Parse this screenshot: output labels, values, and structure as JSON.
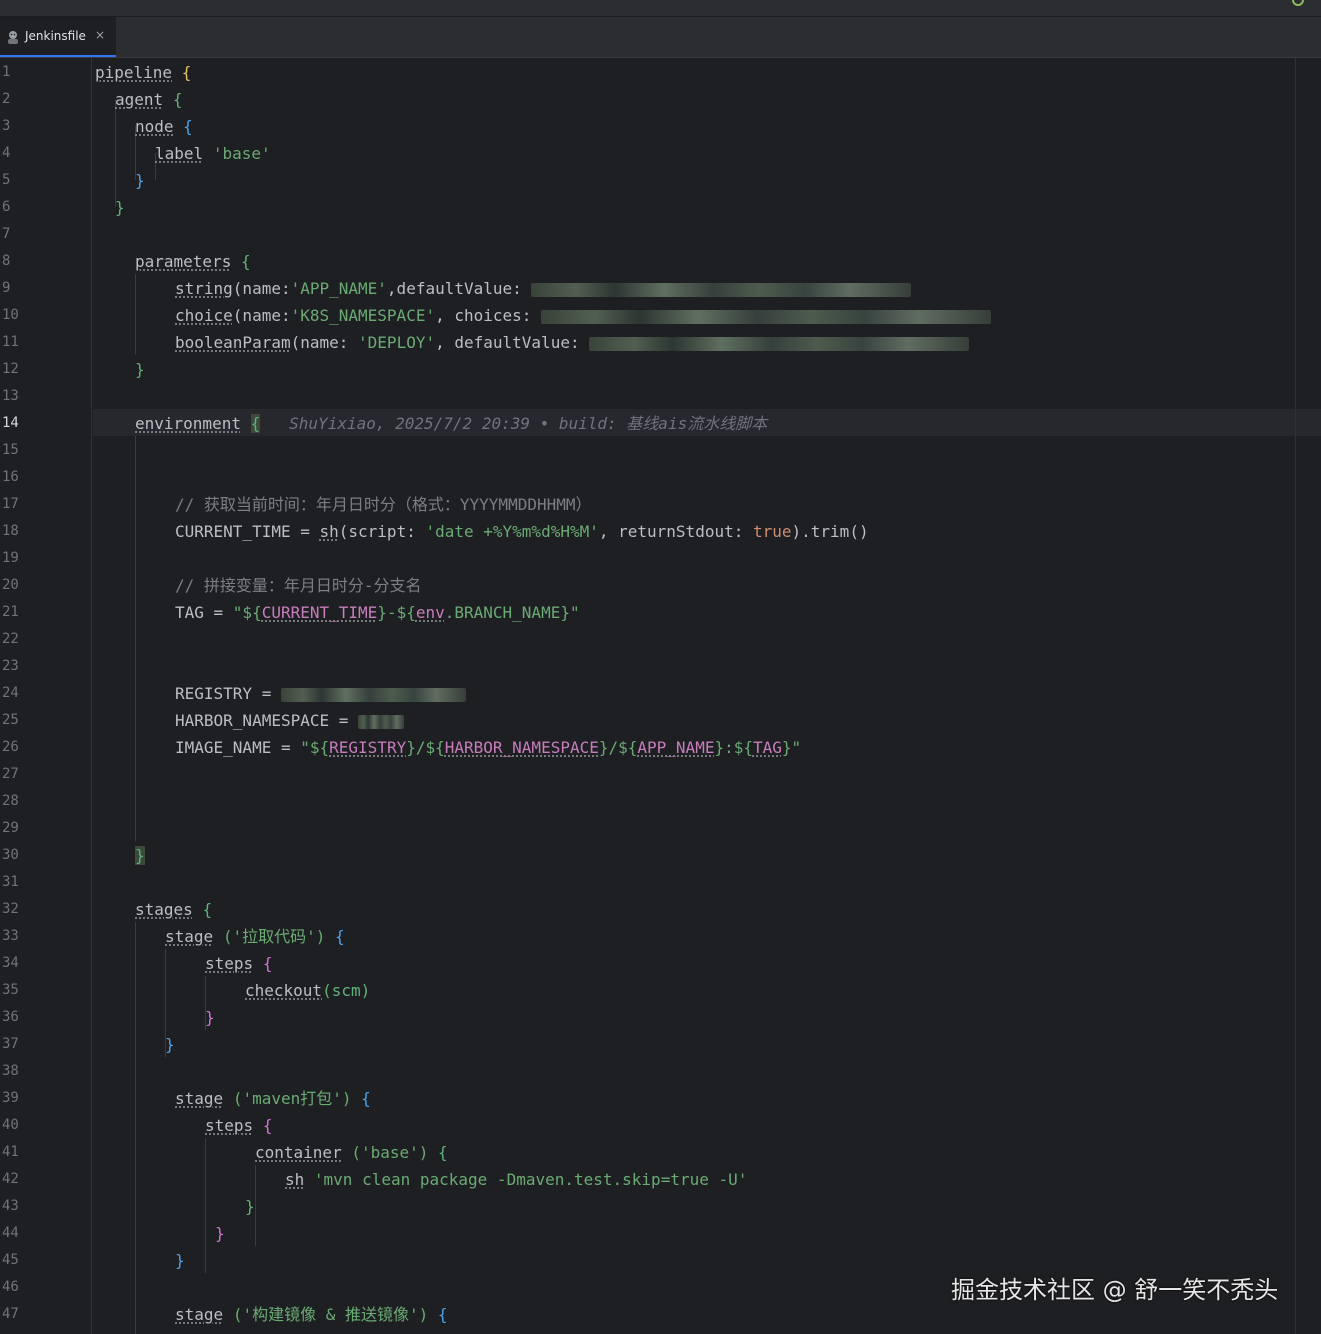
{
  "tab": {
    "label": "Jenkinsfile",
    "close": "×"
  },
  "line_numbers": [
    "1",
    "2",
    "3",
    "4",
    "5",
    "6",
    "7",
    "8",
    "9",
    "10",
    "11",
    "12",
    "13",
    "14",
    "15",
    "16",
    "17",
    "18",
    "19",
    "20",
    "21",
    "22",
    "23",
    "24",
    "25",
    "26",
    "27",
    "28",
    "29",
    "30",
    "31",
    "32",
    "33",
    "34",
    "35",
    "36",
    "37",
    "38",
    "39",
    "40",
    "41",
    "42",
    "43",
    "44",
    "45",
    "46",
    "47"
  ],
  "current_line": "14",
  "code": {
    "l1_kw": "pipeline",
    "l2_kw": "agent",
    "l3_kw": "node",
    "l4_kw": "label",
    "l4_str": "'base'",
    "l8_kw": "parameters",
    "l9_kw": "string",
    "l9_a": "(name:",
    "l9_str": "'APP_NAME'",
    "l9_b": ",defaultValue:",
    "l10_kw": "choice",
    "l10_a": "(name:",
    "l10_str": "'K8S_NAMESPACE'",
    "l10_b": ", choices:",
    "l11_kw": "booleanParam",
    "l11_a": "(name:",
    "l11_str": "'DEPLOY'",
    "l11_b": ", defaultValue:",
    "l14_kw": "environment",
    "l14_blame": "ShuYixiao, 2025/7/2 20:39 • build: 基线ais流水线脚本",
    "l17_cmt": "// 获取当前时间：年月日时分（格式：YYYYMMDDHHMM）",
    "l18_a": "CURRENT_TIME = ",
    "l18_kw": "sh",
    "l18_b": "(script: ",
    "l18_str": "'date +%Y%m%d%H%M'",
    "l18_c": ", returnStdout: ",
    "l18_lit": "true",
    "l18_d": ").trim()",
    "l20_cmt": "// 拼接变量：年月日时分-分支名",
    "l21_a": "TAG = ",
    "l21_q1": "\"${",
    "l21_v1": "CURRENT_TIME",
    "l21_m": "}-${",
    "l21_v2": "env",
    "l21_e": ".BRANCH_NAME}\"",
    "l24_a": "REGISTRY = ",
    "l25_a": "HARBOR_NAMESPACE = ",
    "l26_a": "IMAGE_NAME = ",
    "l26_q": "\"${",
    "l26_v1": "REGISTRY",
    "l26_m1": "}/${",
    "l26_v2": "HARBOR_NAMESPACE",
    "l26_m2": "}/${",
    "l26_v3": "APP_NAME",
    "l26_m3": "}:${",
    "l26_v4": "TAG",
    "l26_e": "}\"",
    "l32_kw": "stages",
    "l33_kw": "stage",
    "l33_str": "('拉取代码')",
    "l34_kw": "steps",
    "l35_kw": "checkout",
    "l35_b": "(scm)",
    "l39_kw": "stage",
    "l39_str": "('maven打包')",
    "l40_kw": "steps",
    "l41_kw": "container",
    "l41_str": "('base')",
    "l42_kw": "sh",
    "l42_str": "'mvn clean package -Dmaven.test.skip=true -U'",
    "l47_kw": "stage",
    "l47_str": "('构建镜像 & 推送镜像')",
    "open": "{",
    "close": "}"
  },
  "watermark": "掘金技术社区 @ 舒一笑不秃头",
  "colors": {
    "background": "#1e1f22",
    "string": "#6aab73",
    "keyword_literal": "#cf8e6d",
    "comment": "#7a7e85",
    "tab_underline": "#3574f0"
  }
}
